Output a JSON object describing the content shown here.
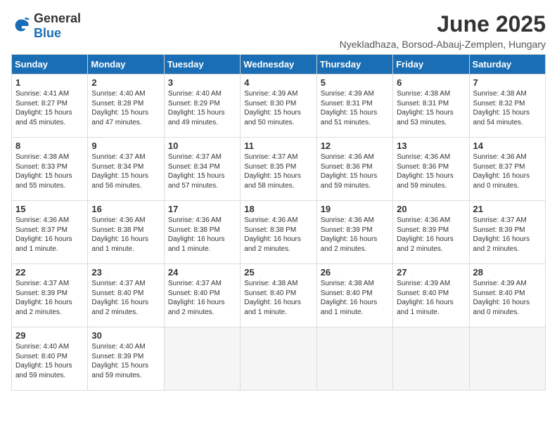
{
  "logo": {
    "general": "General",
    "blue": "Blue"
  },
  "title": "June 2025",
  "subtitle": "Nyekladhaza, Borsod-Abauj-Zemplen, Hungary",
  "headers": [
    "Sunday",
    "Monday",
    "Tuesday",
    "Wednesday",
    "Thursday",
    "Friday",
    "Saturday"
  ],
  "weeks": [
    [
      {
        "day": 1,
        "info": "Sunrise: 4:41 AM\nSunset: 8:27 PM\nDaylight: 15 hours\nand 45 minutes."
      },
      {
        "day": 2,
        "info": "Sunrise: 4:40 AM\nSunset: 8:28 PM\nDaylight: 15 hours\nand 47 minutes."
      },
      {
        "day": 3,
        "info": "Sunrise: 4:40 AM\nSunset: 8:29 PM\nDaylight: 15 hours\nand 49 minutes."
      },
      {
        "day": 4,
        "info": "Sunrise: 4:39 AM\nSunset: 8:30 PM\nDaylight: 15 hours\nand 50 minutes."
      },
      {
        "day": 5,
        "info": "Sunrise: 4:39 AM\nSunset: 8:31 PM\nDaylight: 15 hours\nand 51 minutes."
      },
      {
        "day": 6,
        "info": "Sunrise: 4:38 AM\nSunset: 8:31 PM\nDaylight: 15 hours\nand 53 minutes."
      },
      {
        "day": 7,
        "info": "Sunrise: 4:38 AM\nSunset: 8:32 PM\nDaylight: 15 hours\nand 54 minutes."
      }
    ],
    [
      {
        "day": 8,
        "info": "Sunrise: 4:38 AM\nSunset: 8:33 PM\nDaylight: 15 hours\nand 55 minutes."
      },
      {
        "day": 9,
        "info": "Sunrise: 4:37 AM\nSunset: 8:34 PM\nDaylight: 15 hours\nand 56 minutes."
      },
      {
        "day": 10,
        "info": "Sunrise: 4:37 AM\nSunset: 8:34 PM\nDaylight: 15 hours\nand 57 minutes."
      },
      {
        "day": 11,
        "info": "Sunrise: 4:37 AM\nSunset: 8:35 PM\nDaylight: 15 hours\nand 58 minutes."
      },
      {
        "day": 12,
        "info": "Sunrise: 4:36 AM\nSunset: 8:36 PM\nDaylight: 15 hours\nand 59 minutes."
      },
      {
        "day": 13,
        "info": "Sunrise: 4:36 AM\nSunset: 8:36 PM\nDaylight: 15 hours\nand 59 minutes."
      },
      {
        "day": 14,
        "info": "Sunrise: 4:36 AM\nSunset: 8:37 PM\nDaylight: 16 hours\nand 0 minutes."
      }
    ],
    [
      {
        "day": 15,
        "info": "Sunrise: 4:36 AM\nSunset: 8:37 PM\nDaylight: 16 hours\nand 1 minute."
      },
      {
        "day": 16,
        "info": "Sunrise: 4:36 AM\nSunset: 8:38 PM\nDaylight: 16 hours\nand 1 minute."
      },
      {
        "day": 17,
        "info": "Sunrise: 4:36 AM\nSunset: 8:38 PM\nDaylight: 16 hours\nand 1 minute."
      },
      {
        "day": 18,
        "info": "Sunrise: 4:36 AM\nSunset: 8:38 PM\nDaylight: 16 hours\nand 2 minutes."
      },
      {
        "day": 19,
        "info": "Sunrise: 4:36 AM\nSunset: 8:39 PM\nDaylight: 16 hours\nand 2 minutes."
      },
      {
        "day": 20,
        "info": "Sunrise: 4:36 AM\nSunset: 8:39 PM\nDaylight: 16 hours\nand 2 minutes."
      },
      {
        "day": 21,
        "info": "Sunrise: 4:37 AM\nSunset: 8:39 PM\nDaylight: 16 hours\nand 2 minutes."
      }
    ],
    [
      {
        "day": 22,
        "info": "Sunrise: 4:37 AM\nSunset: 8:39 PM\nDaylight: 16 hours\nand 2 minutes."
      },
      {
        "day": 23,
        "info": "Sunrise: 4:37 AM\nSunset: 8:40 PM\nDaylight: 16 hours\nand 2 minutes."
      },
      {
        "day": 24,
        "info": "Sunrise: 4:37 AM\nSunset: 8:40 PM\nDaylight: 16 hours\nand 2 minutes."
      },
      {
        "day": 25,
        "info": "Sunrise: 4:38 AM\nSunset: 8:40 PM\nDaylight: 16 hours\nand 1 minute."
      },
      {
        "day": 26,
        "info": "Sunrise: 4:38 AM\nSunset: 8:40 PM\nDaylight: 16 hours\nand 1 minute."
      },
      {
        "day": 27,
        "info": "Sunrise: 4:39 AM\nSunset: 8:40 PM\nDaylight: 16 hours\nand 1 minute."
      },
      {
        "day": 28,
        "info": "Sunrise: 4:39 AM\nSunset: 8:40 PM\nDaylight: 16 hours\nand 0 minutes."
      }
    ],
    [
      {
        "day": 29,
        "info": "Sunrise: 4:40 AM\nSunset: 8:40 PM\nDaylight: 15 hours\nand 59 minutes."
      },
      {
        "day": 30,
        "info": "Sunrise: 4:40 AM\nSunset: 8:39 PM\nDaylight: 15 hours\nand 59 minutes."
      },
      null,
      null,
      null,
      null,
      null
    ]
  ]
}
